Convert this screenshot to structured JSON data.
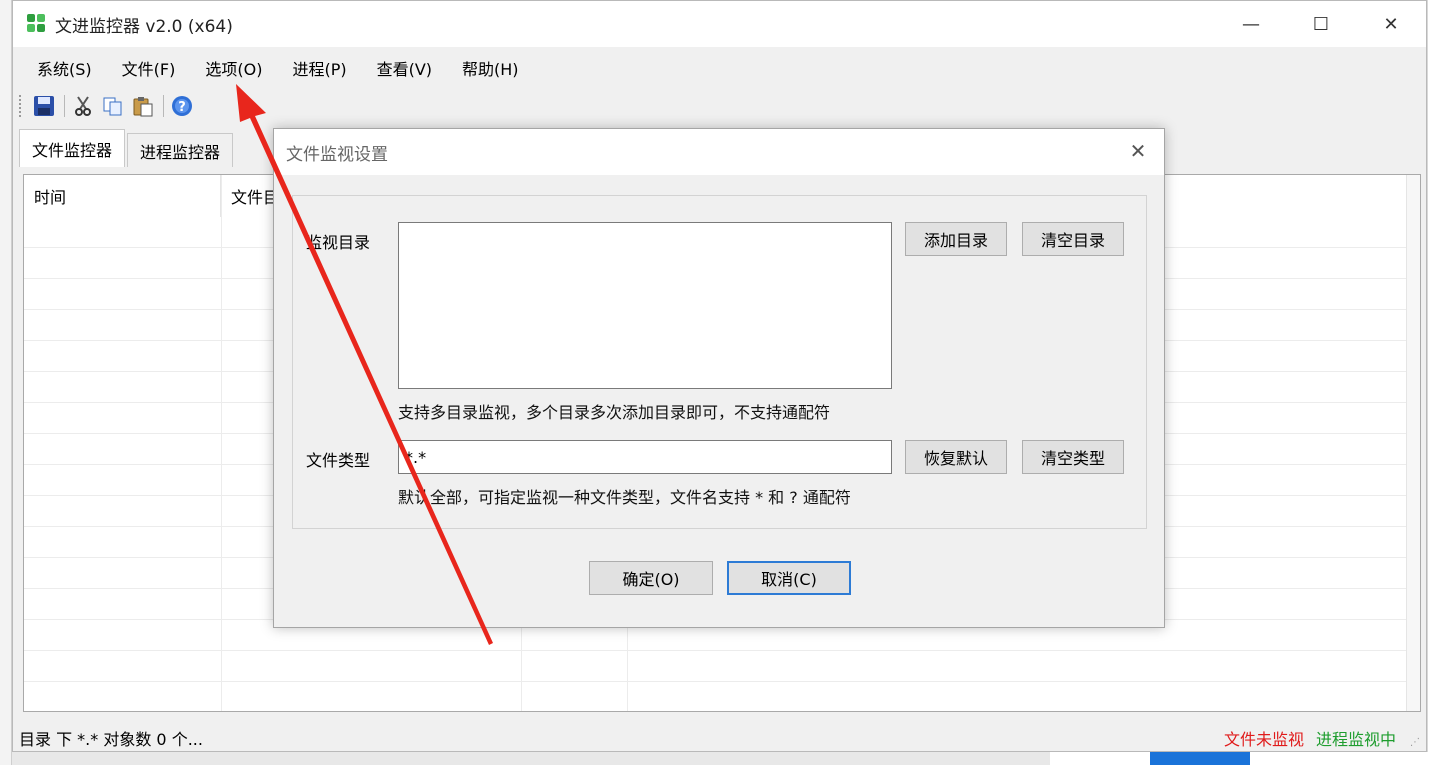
{
  "app": {
    "title": "文进监控器 v2.0 (x64)",
    "controls": {
      "minimize": "—",
      "maximize": "☐",
      "close": "✕"
    }
  },
  "menu": [
    "系统(S)",
    "文件(F)",
    "选项(O)",
    "进程(P)",
    "查看(V)",
    "帮助(H)"
  ],
  "toolbar": {
    "icons": [
      "save-icon",
      "cut-icon",
      "copy-icon",
      "paste-icon",
      "help-icon"
    ]
  },
  "tabs": [
    "文件监控器",
    "进程监控器"
  ],
  "list": {
    "columns": [
      "时间",
      "文件目"
    ]
  },
  "status": {
    "left": "目录  下 *.* 对象数 0 个...",
    "file_state": "文件未监视",
    "process_state": "进程监视中"
  },
  "dialog": {
    "title": "文件监视设置",
    "close": "✕",
    "dir_label": "监视目录",
    "add_dir": "添加目录",
    "clear_dir": "清空目录",
    "dir_hint": "支持多目录监视，多个目录多次添加目录即可，不支持通配符",
    "type_label": "文件类型",
    "type_value": "*.*",
    "restore_default": "恢复默认",
    "clear_type": "清空类型",
    "type_hint": "默认全部，可指定监视一种文件类型，文件名支持 * 和 ? 通配符",
    "ok": "确定(O)",
    "cancel": "取消(C)"
  },
  "colors": {
    "status_red": "#e01b1b",
    "status_green": "#1e9d2e",
    "annotation_arrow": "#e8261c",
    "default_button_border": "#2d7bd5"
  }
}
